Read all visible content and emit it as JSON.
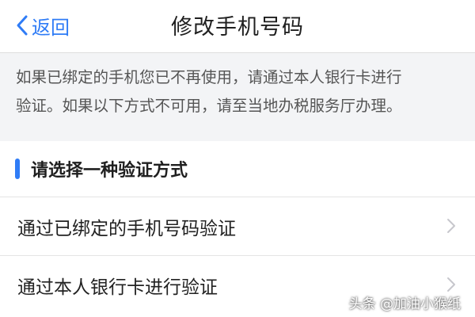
{
  "nav": {
    "back_label": "返回",
    "title": "修改手机号码",
    "back_icon": "chevron-left-icon"
  },
  "notice": {
    "line1": "如果已绑定的手机您已不再使用，请通过本人银行卡进行",
    "line2": "验证。如果以下方式不可用，请至当地办税服务厅办理。"
  },
  "section": {
    "title": "请选择一种验证方式"
  },
  "options": [
    {
      "label": "通过已绑定的手机号码验证",
      "icon": "chevron-right-icon"
    },
    {
      "label": "通过本人银行卡进行验证",
      "icon": "chevron-right-icon"
    }
  ],
  "watermark": "头条 @加油小猴纸",
  "colors": {
    "accent": "#2f7cf6",
    "notice_bg": "#f3f4f6",
    "chevron": "#c7c7cc"
  }
}
